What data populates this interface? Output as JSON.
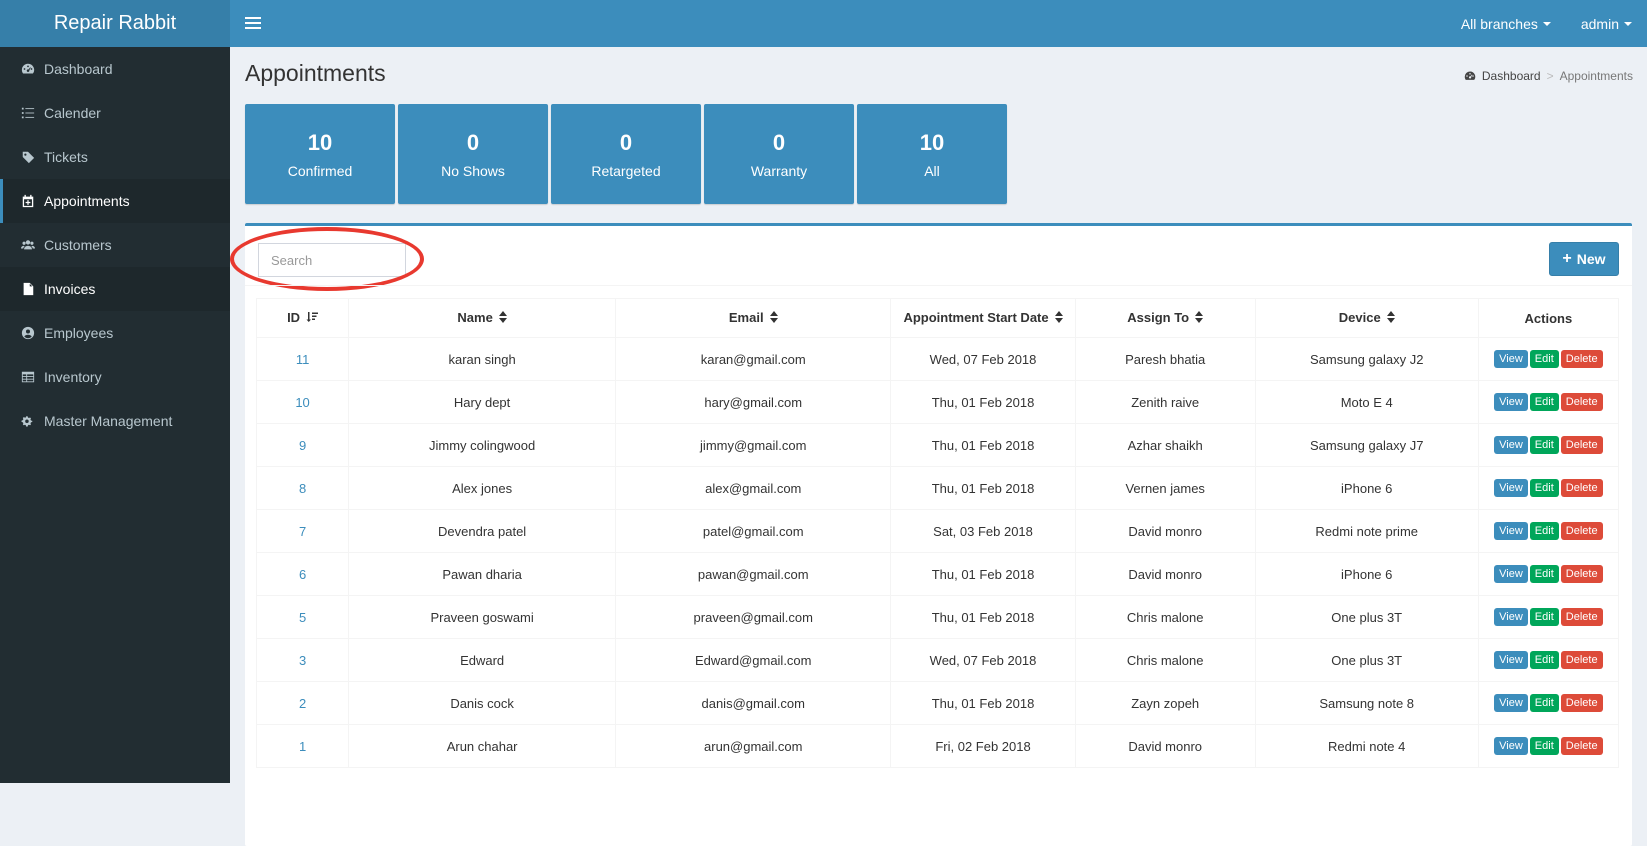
{
  "app": {
    "title": "Repair Rabbit"
  },
  "sidebar": {
    "items": [
      {
        "label": "Dashboard",
        "icon": "dashboard-icon"
      },
      {
        "label": "Calender",
        "icon": "list-icon"
      },
      {
        "label": "Tickets",
        "icon": "tag-icon"
      },
      {
        "label": "Appointments",
        "icon": "calendar-plus-icon"
      },
      {
        "label": "Customers",
        "icon": "users-icon"
      },
      {
        "label": "Invoices",
        "icon": "file-icon"
      },
      {
        "label": "Employees",
        "icon": "user-circle-icon"
      },
      {
        "label": "Inventory",
        "icon": "table-icon"
      },
      {
        "label": "Master Management",
        "icon": "gears-icon"
      }
    ]
  },
  "header": {
    "branches": "All branches",
    "user": "admin"
  },
  "page": {
    "title": "Appointments"
  },
  "breadcrumb": {
    "home": "Dashboard",
    "separator": ">",
    "current": "Appointments"
  },
  "stats": [
    {
      "value": "10",
      "label": "Confirmed"
    },
    {
      "value": "0",
      "label": "No Shows"
    },
    {
      "value": "0",
      "label": "Retargeted"
    },
    {
      "value": "0",
      "label": "Warranty"
    },
    {
      "value": "10",
      "label": "All"
    }
  ],
  "search": {
    "placeholder": "Search"
  },
  "toolbar": {
    "new_label": "New"
  },
  "table": {
    "columns": [
      "ID",
      "Name",
      "Email",
      "Appointment Start Date",
      "Assign To",
      "Device",
      "Actions"
    ],
    "actions": {
      "view": "View",
      "edit": "Edit",
      "delete": "Delete"
    },
    "rows": [
      {
        "id": "11",
        "name": "karan singh",
        "email": "karan@gmail.com",
        "date": "Wed, 07 Feb 2018",
        "assign": "Paresh bhatia",
        "device": "Samsung galaxy J2"
      },
      {
        "id": "10",
        "name": "Hary dept",
        "email": "hary@gmail.com",
        "date": "Thu, 01 Feb 2018",
        "assign": "Zenith raive",
        "device": "Moto E 4"
      },
      {
        "id": "9",
        "name": "Jimmy colingwood",
        "email": "jimmy@gmail.com",
        "date": "Thu, 01 Feb 2018",
        "assign": "Azhar shaikh",
        "device": "Samsung galaxy J7"
      },
      {
        "id": "8",
        "name": "Alex jones",
        "email": "alex@gmail.com",
        "date": "Thu, 01 Feb 2018",
        "assign": "Vernen james",
        "device": "iPhone 6"
      },
      {
        "id": "7",
        "name": "Devendra patel",
        "email": "patel@gmail.com",
        "date": "Sat, 03 Feb 2018",
        "assign": "David monro",
        "device": "Redmi note prime"
      },
      {
        "id": "6",
        "name": "Pawan dharia",
        "email": "pawan@gmail.com",
        "date": "Thu, 01 Feb 2018",
        "assign": "David monro",
        "device": "iPhone 6"
      },
      {
        "id": "5",
        "name": "Praveen goswami",
        "email": "praveen@gmail.com",
        "date": "Thu, 01 Feb 2018",
        "assign": "Chris malone",
        "device": "One plus 3T"
      },
      {
        "id": "3",
        "name": "Edward",
        "email": "Edward@gmail.com",
        "date": "Wed, 07 Feb 2018",
        "assign": "Chris malone",
        "device": "One plus 3T"
      },
      {
        "id": "2",
        "name": "Danis cock",
        "email": "danis@gmail.com",
        "date": "Thu, 01 Feb 2018",
        "assign": "Zayn zopeh",
        "device": "Samsung note 8"
      },
      {
        "id": "1",
        "name": "Arun chahar",
        "email": "arun@gmail.com",
        "date": "Fri, 02 Feb 2018",
        "assign": "David monro",
        "device": "Redmi note 4"
      }
    ]
  },
  "colors": {
    "primary": "#3c8dbc",
    "sidebar": "#222d32",
    "success": "#00a65a",
    "danger": "#dd4b39",
    "highlight": "#e8392f"
  }
}
